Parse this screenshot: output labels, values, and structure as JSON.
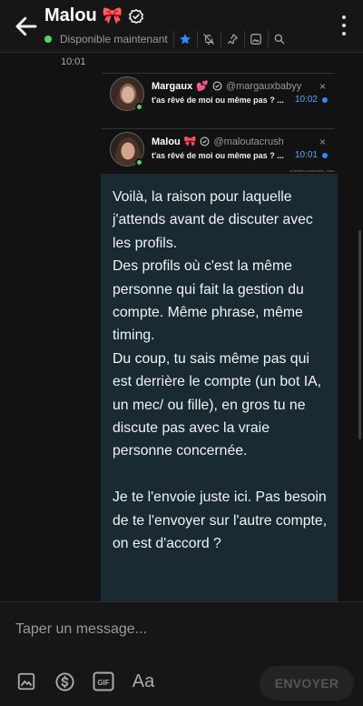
{
  "header": {
    "title": "Malou",
    "status": "Disponible maintenant"
  },
  "messages": {
    "time_top": "10:01",
    "quotes": [
      {
        "name": "Margaux",
        "name_emoji": "💕",
        "handle": "@margauxbabyy",
        "preview": "t'as rêvé de moi ou même pas ? ...",
        "time": "10:02",
        "close": "×"
      },
      {
        "name": "Malou",
        "name_emoji": "🎀",
        "handle": "@maloutacrush",
        "preview": "t'as rêvé de moi ou même pas ? ...",
        "time": "10:01",
        "close": "×",
        "micro": "crushfans.com/malou_maxx"
      }
    ],
    "bubble_text": "Voilà, la raison pour laquelle j'attends avant de discuter avec les profils.\nDes profils où c'est la même personne qui fait la gestion du compte. Même phrase, même timing.\nDu coup, tu sais même pas qui est derrière le compte (un bot IA, un mec/ ou fille), en gros tu ne discute pas avec la vraie personne concernée.\n\nJe te l'envoie juste ici. Pas besoin de te l'envoyer sur l'autre compte, on est d'accord ?"
  },
  "composer": {
    "placeholder": "Taper un message...",
    "send_label": "ENVOYER",
    "gif_label": "GIF",
    "text_label": "Aa"
  },
  "colors": {
    "accent_blue": "#2f8cff",
    "online_green": "#4cd964",
    "bubble_bg": "#1a2a33",
    "bow_red": "#e3344a"
  }
}
